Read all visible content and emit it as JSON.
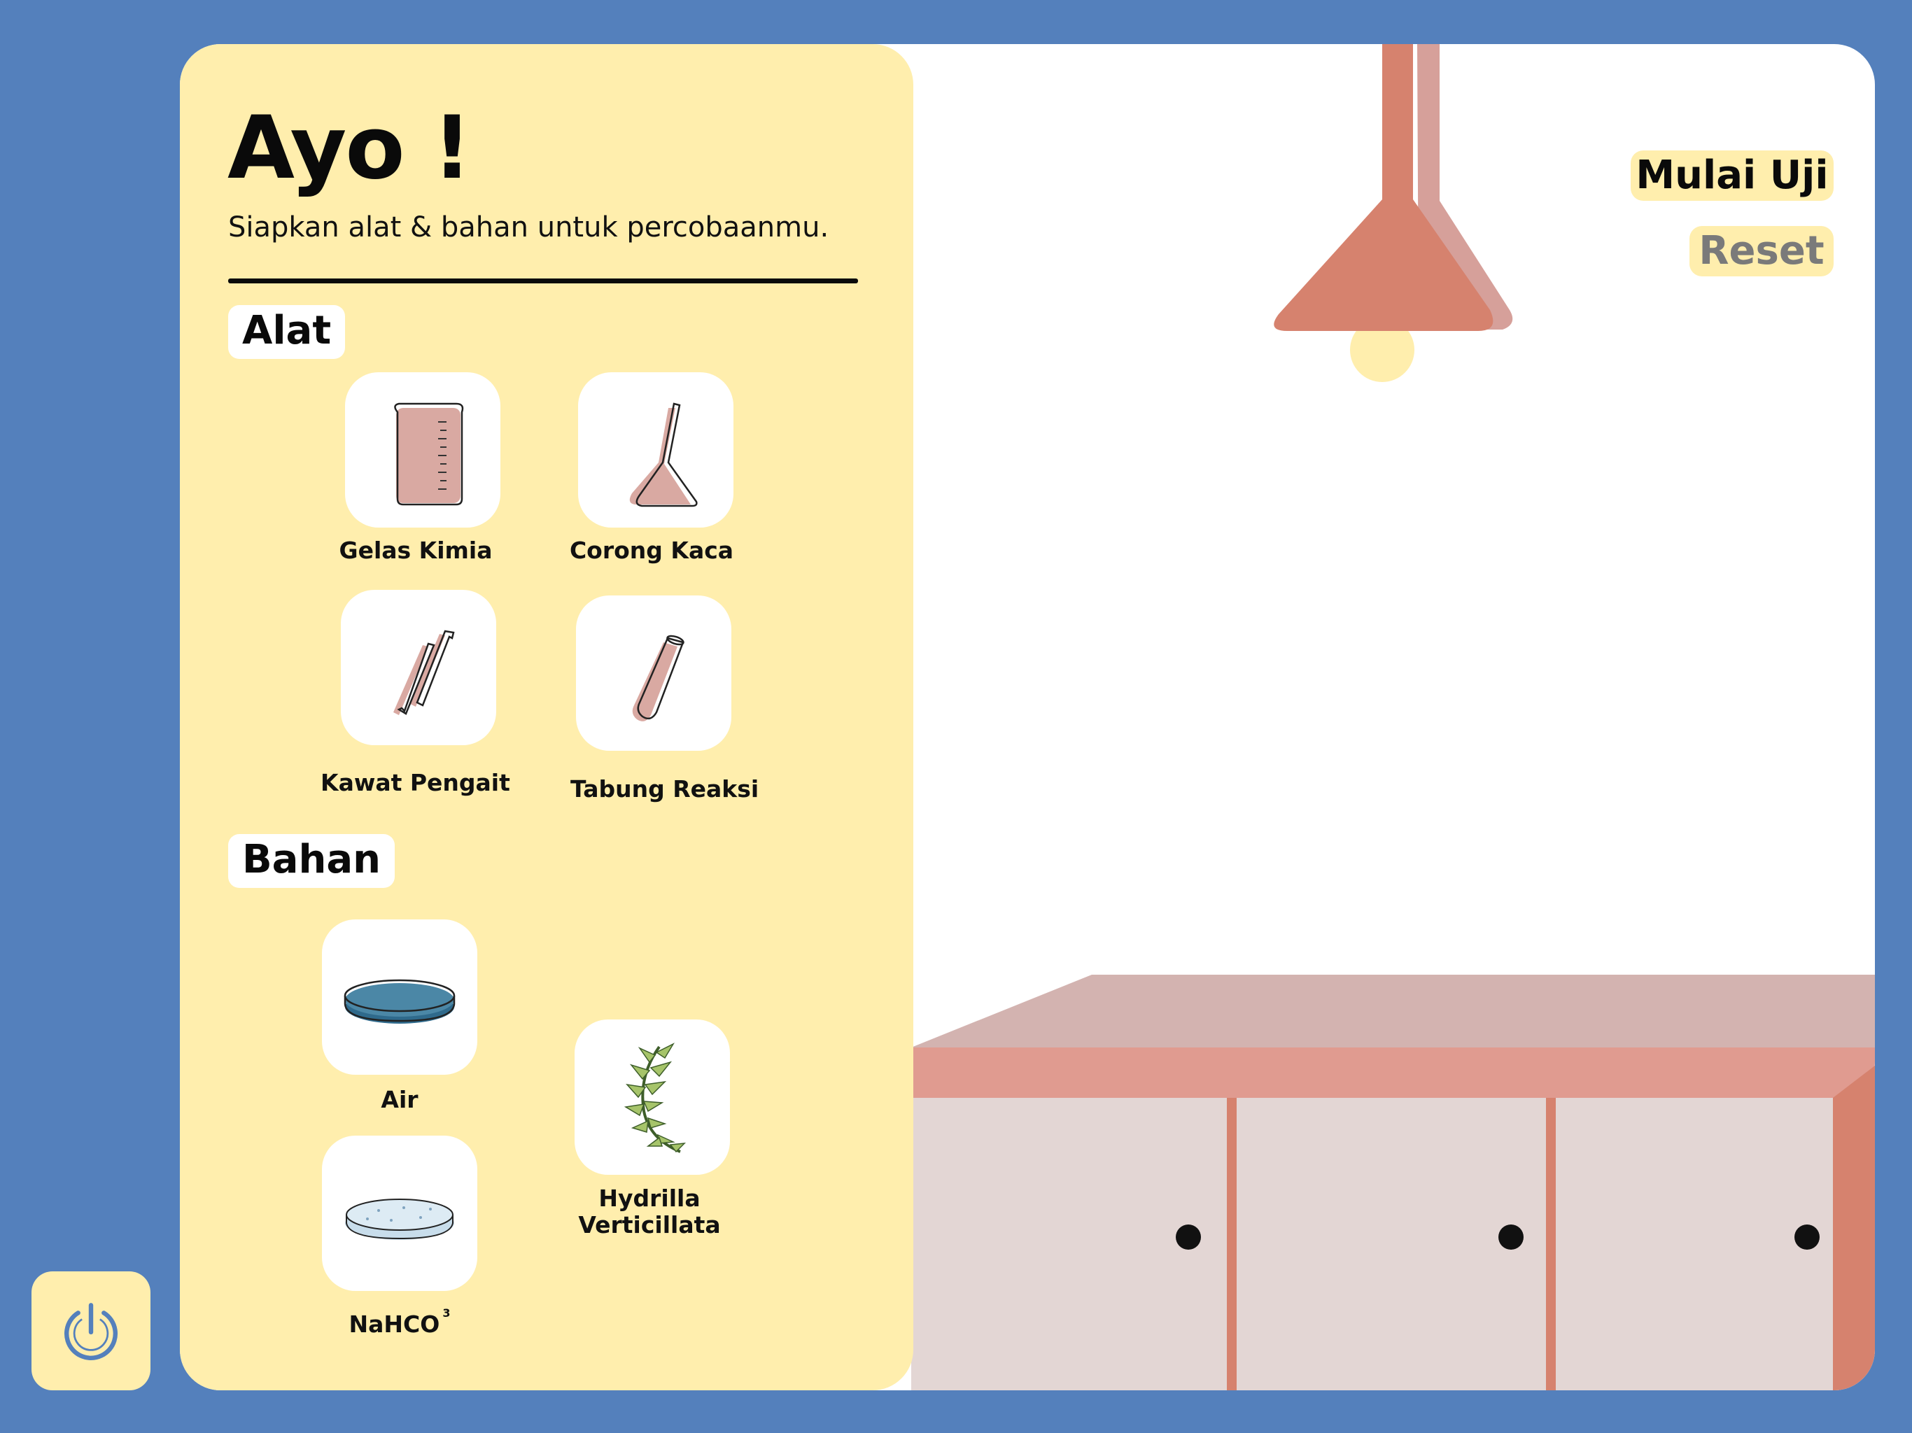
{
  "panel": {
    "title": "Ayo !",
    "subtitle": "Siapkan alat & bahan untuk percobaanmu."
  },
  "alat": {
    "heading": "Alat",
    "items": [
      {
        "label": "Gelas Kimia",
        "icon": "beaker-icon"
      },
      {
        "label": "Corong Kaca",
        "icon": "funnel-icon"
      },
      {
        "label": "Kawat Pengait",
        "icon": "hook-wire-icon"
      },
      {
        "label": "Tabung Reaksi",
        "icon": "test-tube-icon"
      }
    ]
  },
  "bahan": {
    "heading": "Bahan",
    "items": [
      {
        "label": "Air",
        "icon": "water-dish-icon"
      },
      {
        "label": "Hydrilla Verticillata",
        "line1": "Hydrilla",
        "line2": "Verticillata",
        "icon": "hydrilla-plant-icon"
      },
      {
        "label": "NaHCO",
        "superscript": "3",
        "icon": "sodium-bicarbonate-dish-icon"
      }
    ]
  },
  "controls": {
    "start_label": "Mulai Uji",
    "reset_label": "Reset",
    "power_icon": "power-icon"
  },
  "colors": {
    "background": "#5480BC",
    "panel": "#FFEEAD",
    "lamp": "#D6826E",
    "counter_top": "#D3B3B0",
    "counter_edge": "#E09B90",
    "cabinet": "#E3D6D4"
  }
}
